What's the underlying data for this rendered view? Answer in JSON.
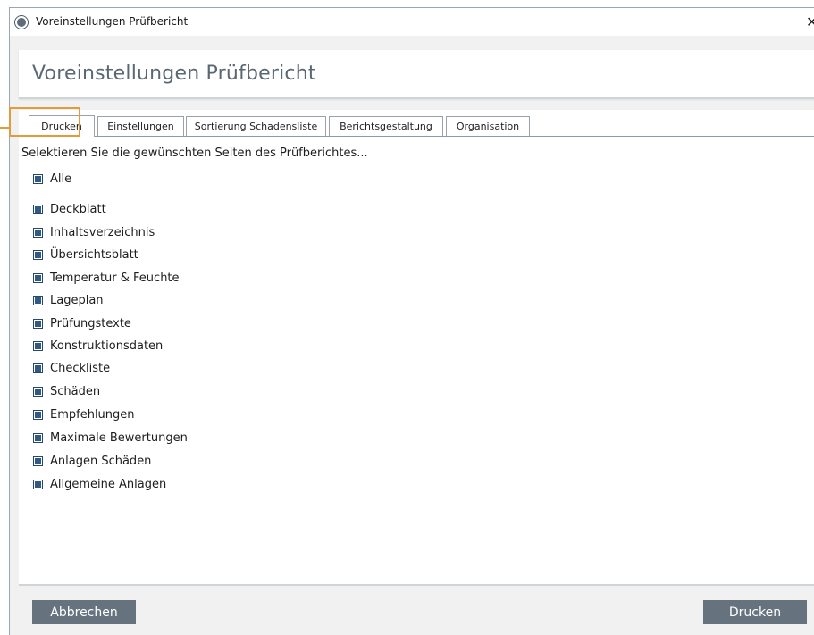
{
  "window": {
    "title": "Voreinstellungen Prüfbericht",
    "close_glyph": "✕"
  },
  "header": {
    "title": "Voreinstellungen Prüfbericht"
  },
  "tabs": [
    {
      "label": "Drucken",
      "active": true
    },
    {
      "label": "Einstellungen",
      "active": false
    },
    {
      "label": "Sortierung Schadensliste",
      "active": false
    },
    {
      "label": "Berichtsgestaltung",
      "active": false
    },
    {
      "label": "Organisation",
      "active": false
    }
  ],
  "content": {
    "intro": "Selektieren Sie die gewünschten Seiten des Prüfberichtes...",
    "all_option": {
      "label": "Alle",
      "checked": true
    },
    "pages": [
      {
        "label": "Deckblatt",
        "checked": true
      },
      {
        "label": "Inhaltsverzeichnis",
        "checked": true
      },
      {
        "label": "Übersichtsblatt",
        "checked": true
      },
      {
        "label": "Temperatur & Feuchte",
        "checked": true
      },
      {
        "label": "Lageplan",
        "checked": true
      },
      {
        "label": "Prüfungstexte",
        "checked": true
      },
      {
        "label": "Konstruktionsdaten",
        "checked": true
      },
      {
        "label": "Checkliste",
        "checked": true
      },
      {
        "label": "Schäden",
        "checked": true
      },
      {
        "label": "Empfehlungen",
        "checked": true
      },
      {
        "label": "Maximale Bewertungen",
        "checked": true
      },
      {
        "label": "Anlagen Schäden",
        "checked": true
      },
      {
        "label": "Allgemeine Anlagen",
        "checked": true
      }
    ]
  },
  "footer": {
    "cancel_label": "Abbrechen",
    "print_label": "Drucken"
  },
  "colors": {
    "highlight": "#e39a3b",
    "button": "#66737f",
    "checkbox_fill": "#2f5a86"
  }
}
